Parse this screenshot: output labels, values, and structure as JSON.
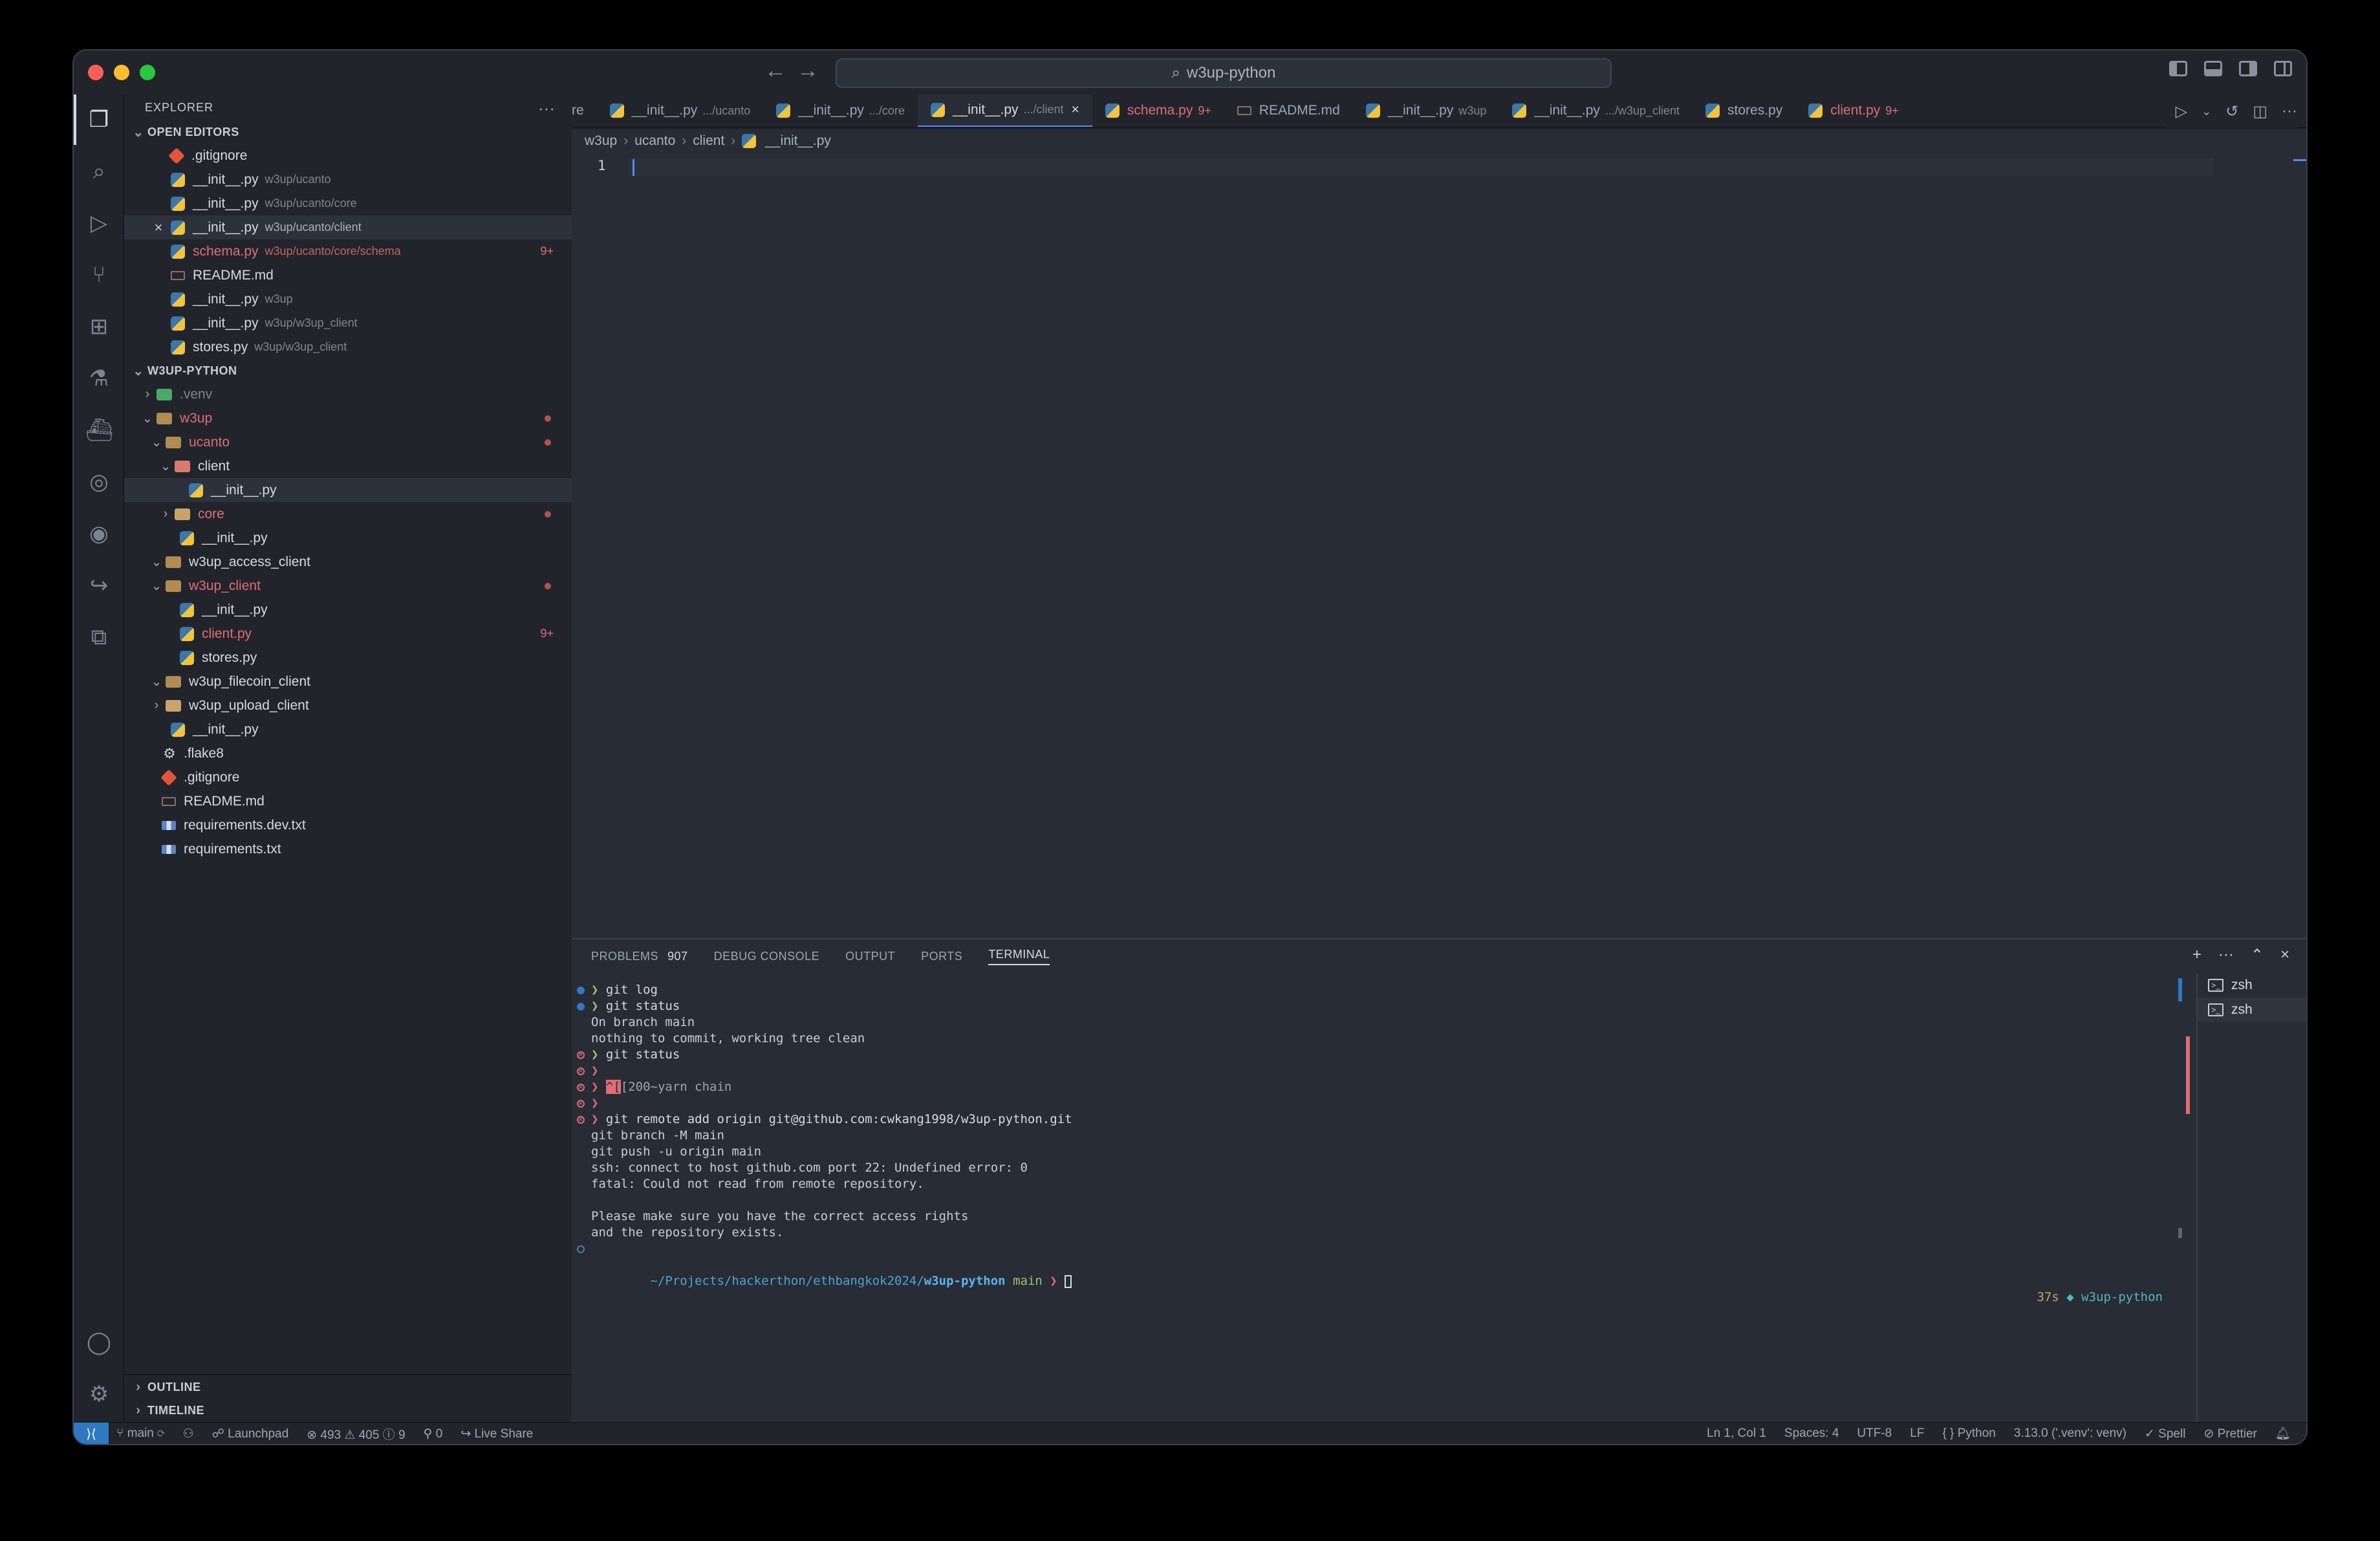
{
  "titlebar": {
    "search": "w3up-python"
  },
  "explorer": {
    "title": "EXPLORER",
    "open_editors_title": "OPEN EDITORS",
    "open_editors": [
      {
        "name": ".gitignore",
        "desc": "",
        "icon": "git-icon"
      },
      {
        "name": "__init__.py",
        "desc": "w3up/ucanto",
        "icon": "python-icon"
      },
      {
        "name": "__init__.py",
        "desc": "w3up/ucanto/core",
        "icon": "python-icon"
      },
      {
        "name": "__init__.py",
        "desc": "w3up/ucanto/client",
        "icon": "python-icon",
        "active": true
      },
      {
        "name": "schema.py",
        "desc": "w3up/ucanto/core/schema",
        "icon": "python-icon",
        "badge": "9+",
        "error": true
      },
      {
        "name": "README.md",
        "desc": "",
        "icon": "markdown-icon"
      },
      {
        "name": "__init__.py",
        "desc": "w3up",
        "icon": "python-icon"
      },
      {
        "name": "__init__.py",
        "desc": "w3up/w3up_client",
        "icon": "python-icon"
      },
      {
        "name": "stores.py",
        "desc": "w3up/w3up_client",
        "icon": "python-icon"
      }
    ],
    "project_title": "W3UP-PYTHON",
    "tree": {
      "venv": ".venv",
      "w3up": "w3up",
      "ucanto": "ucanto",
      "client": "client",
      "client_init": "__init__.py",
      "core": "core",
      "ucanto_init": "__init__.py",
      "access_client": "w3up_access_client",
      "w3up_client": "w3up_client",
      "w3up_client_init": "__init__.py",
      "client_py": "client.py",
      "client_py_badge": "9+",
      "stores_py": "stores.py",
      "filecoin_client": "w3up_filecoin_client",
      "upload_client": "w3up_upload_client",
      "w3up_init": "__init__.py",
      "flake8": ".flake8",
      "gitignore": ".gitignore",
      "readme": "README.md",
      "req_dev": "requirements.dev.txt",
      "req": "requirements.txt"
    },
    "outline": "OUTLINE",
    "timeline": "TIMELINE"
  },
  "tabs": [
    {
      "name": "re",
      "desc": ""
    },
    {
      "name": "__init__.py",
      "desc": ".../ucanto"
    },
    {
      "name": "__init__.py",
      "desc": ".../core"
    },
    {
      "name": "__init__.py",
      "desc": ".../client",
      "active": true
    },
    {
      "name": "schema.py",
      "desc": "",
      "badge": "9+",
      "error": true
    },
    {
      "name": "README.md",
      "desc": ""
    },
    {
      "name": "__init__.py",
      "desc": "w3up"
    },
    {
      "name": "__init__.py",
      "desc": ".../w3up_client"
    },
    {
      "name": "stores.py",
      "desc": ""
    },
    {
      "name": "client.py",
      "desc": "",
      "badge": "9+",
      "error": true
    }
  ],
  "breadcrumb": [
    "w3up",
    "ucanto",
    "client",
    "__init__.py"
  ],
  "editor": {
    "line_number": "1"
  },
  "panel": {
    "tabs": {
      "problems": "PROBLEMS",
      "problems_count": "907",
      "debug": "DEBUG CONSOLE",
      "output": "OUTPUT",
      "ports": "PORTS",
      "terminal": "TERMINAL"
    },
    "terminal_lines": {
      "l1": "git log",
      "l2": "git status",
      "l3": "On branch main",
      "l4": "nothing to commit, working tree clean",
      "l5": "git status",
      "l7_esc": "^[",
      "l7": "[200~yarn chain",
      "l9": "git remote add origin git@github.com:cwkang1998/w3up-python.git",
      "l10": "git branch -M main",
      "l11": "git push -u origin main",
      "l12": "ssh: connect to host github.com port 22: Undefined error: 0",
      "l13": "fatal: Could not read from remote repository.",
      "l15": "Please make sure you have the correct access rights",
      "l16": "and the repository exists.",
      "prompt_path": "~/Projects/hackerthon/ethbangkok2024/",
      "prompt_dir": "w3up-python",
      "prompt_branch": "main",
      "prompt_char": "❯",
      "right_time": "37s",
      "right_env": "w3up-python"
    },
    "terminals": [
      "zsh",
      "zsh"
    ]
  },
  "statusbar": {
    "branch": "main",
    "launchpad": "Launchpad",
    "errors": "493",
    "warnings": "405",
    "infos": "9",
    "ports": "0",
    "live_share": "Live Share",
    "position": "Ln 1, Col 1",
    "spaces": "Spaces: 4",
    "encoding": "UTF-8",
    "eol": "LF",
    "language": "Python",
    "interpreter": "3.13.0 ('.venv': venv)",
    "spell": "Spell",
    "prettier": "Prettier"
  }
}
